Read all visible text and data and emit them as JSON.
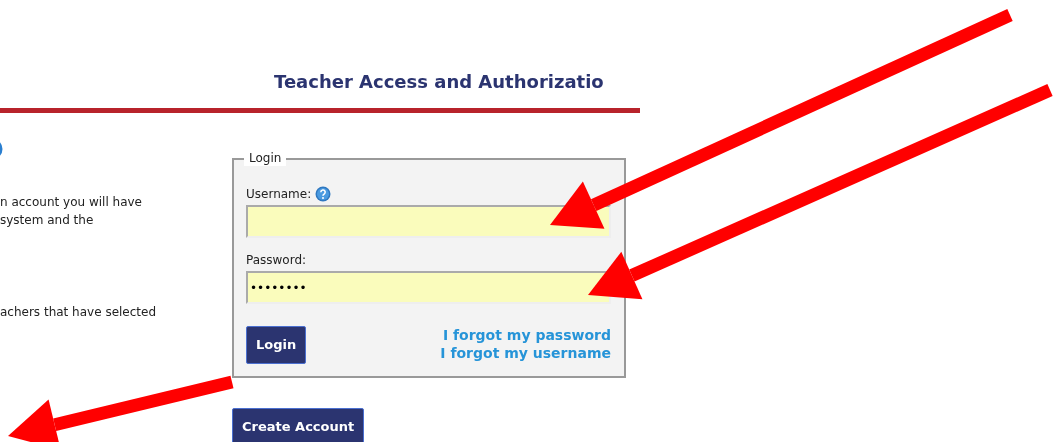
{
  "header": {
    "title": "Teacher Access and Authorizatio"
  },
  "intro_lines": [
    "n account you will have",
    " system and the",
    "achers that have selected"
  ],
  "login": {
    "legend": "Login",
    "fields": [
      {
        "label": "Username:",
        "help": true
      },
      {
        "label": "Password:",
        "help": false,
        "value": "••••••••"
      }
    ],
    "button": "Login",
    "links": [
      "I forgot my password",
      "I forgot my username"
    ]
  },
  "create_button": "Create Account",
  "annotations": [
    {
      "kind": "arrow"
    },
    {
      "kind": "arrow"
    },
    {
      "kind": "arrow"
    }
  ]
}
